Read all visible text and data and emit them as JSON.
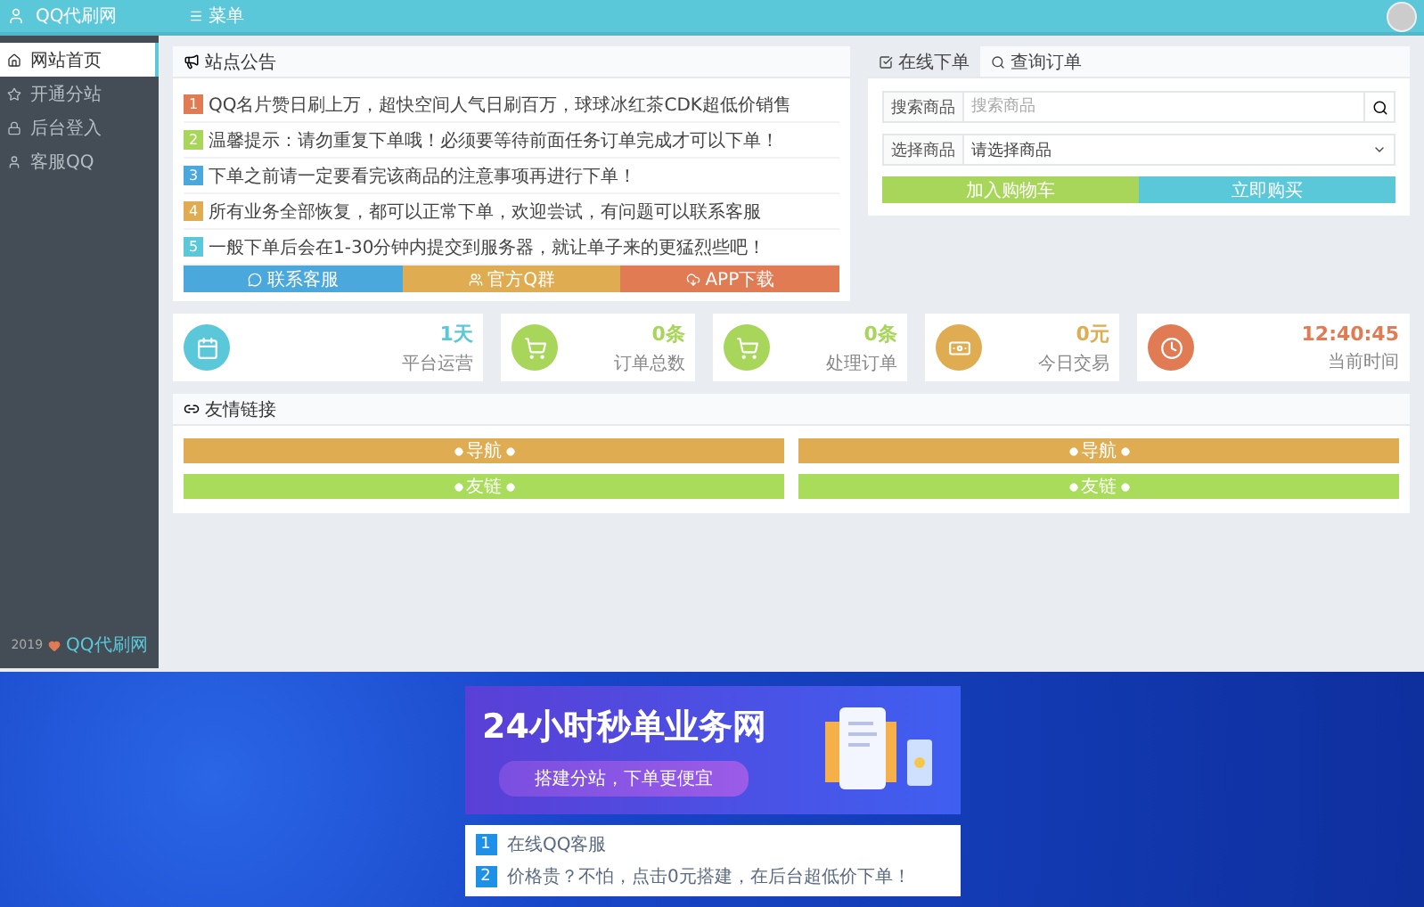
{
  "header": {
    "logo": "QQ代刷网",
    "menu": "菜单"
  },
  "sidebar": {
    "items": [
      {
        "label": "网站首页",
        "selected": true
      },
      {
        "label": "开通分站",
        "selected": false
      },
      {
        "label": "后台登入",
        "selected": false
      },
      {
        "label": "客服QQ",
        "selected": false
      }
    ],
    "footer_year": "2019",
    "footer_site": "QQ代刷网"
  },
  "notice": {
    "title": "站点公告",
    "items": [
      {
        "number": "1",
        "color": "#e07b53",
        "text": "QQ名片赞日刷上万，超快空间人气日刷百万，球球冰红茶CDK超低价销售"
      },
      {
        "number": "2",
        "color": "#a8d65a",
        "text": "温馨提示：请勿重复下单哦！必须要等待前面任务订单完成才可以下单！"
      },
      {
        "number": "3",
        "color": "#4aa8dc",
        "text": "下单之前请一定要看完该商品的注意事项再进行下单！"
      },
      {
        "number": "4",
        "color": "#e0ac52",
        "text": "所有业务全部恢复，都可以正常下单，欢迎尝试，有问题可以联系客服"
      },
      {
        "number": "5",
        "color": "#5bc8da",
        "text": "一般下单后会在1-30分钟内提交到服务器，就让单子来的更猛烈些吧！"
      }
    ],
    "buttons": [
      {
        "label": "联系客服",
        "color": "#4aa8dc"
      },
      {
        "label": "官方Q群",
        "color": "#e0ac52"
      },
      {
        "label": "APP下载",
        "color": "#e07b53"
      }
    ]
  },
  "order": {
    "tabs": [
      {
        "label": "在线下单",
        "selected": true
      },
      {
        "label": "查询订单",
        "selected": false
      }
    ],
    "search": {
      "label": "搜索商品",
      "placeholder": "搜索商品"
    },
    "select": {
      "label": "选择商品",
      "value": "请选择商品"
    },
    "buttons": [
      {
        "label": "加入购物车",
        "color": "#a8d65a"
      },
      {
        "label": "立即购买",
        "color": "#5bc8da"
      }
    ]
  },
  "stats": [
    {
      "kind": "calendar",
      "value": "1天",
      "label": "平台运营",
      "color": "#5bc8da"
    },
    {
      "kind": "cart",
      "value": "0条",
      "label": "订单总数",
      "color": "#a8d65a"
    },
    {
      "kind": "cart",
      "value": "0条",
      "label": "处理订单",
      "color": "#a8d65a"
    },
    {
      "kind": "money",
      "value": "0元",
      "label": "今日交易",
      "color": "#e0ac52"
    },
    {
      "kind": "clock",
      "value": "12:40:45",
      "label": "当前时间",
      "color": "#e07b53"
    }
  ],
  "links": {
    "title": "友情链接",
    "items": [
      {
        "label": "导航",
        "color": "#e0ac52"
      },
      {
        "label": "导航",
        "color": "#e0ac52"
      },
      {
        "label": "友链",
        "color": "#a8dc5a"
      },
      {
        "label": "友链",
        "color": "#a8dc5a"
      }
    ]
  },
  "promo": {
    "banner_title": "24小时秒单业务网",
    "banner_subtitle": "搭建分站，下单更便宜",
    "items": [
      {
        "number": "1",
        "text": "在线QQ客服"
      },
      {
        "number": "2",
        "text": "价格贵？不怕，点击0元搭建，在后台超低价下单！"
      }
    ]
  }
}
